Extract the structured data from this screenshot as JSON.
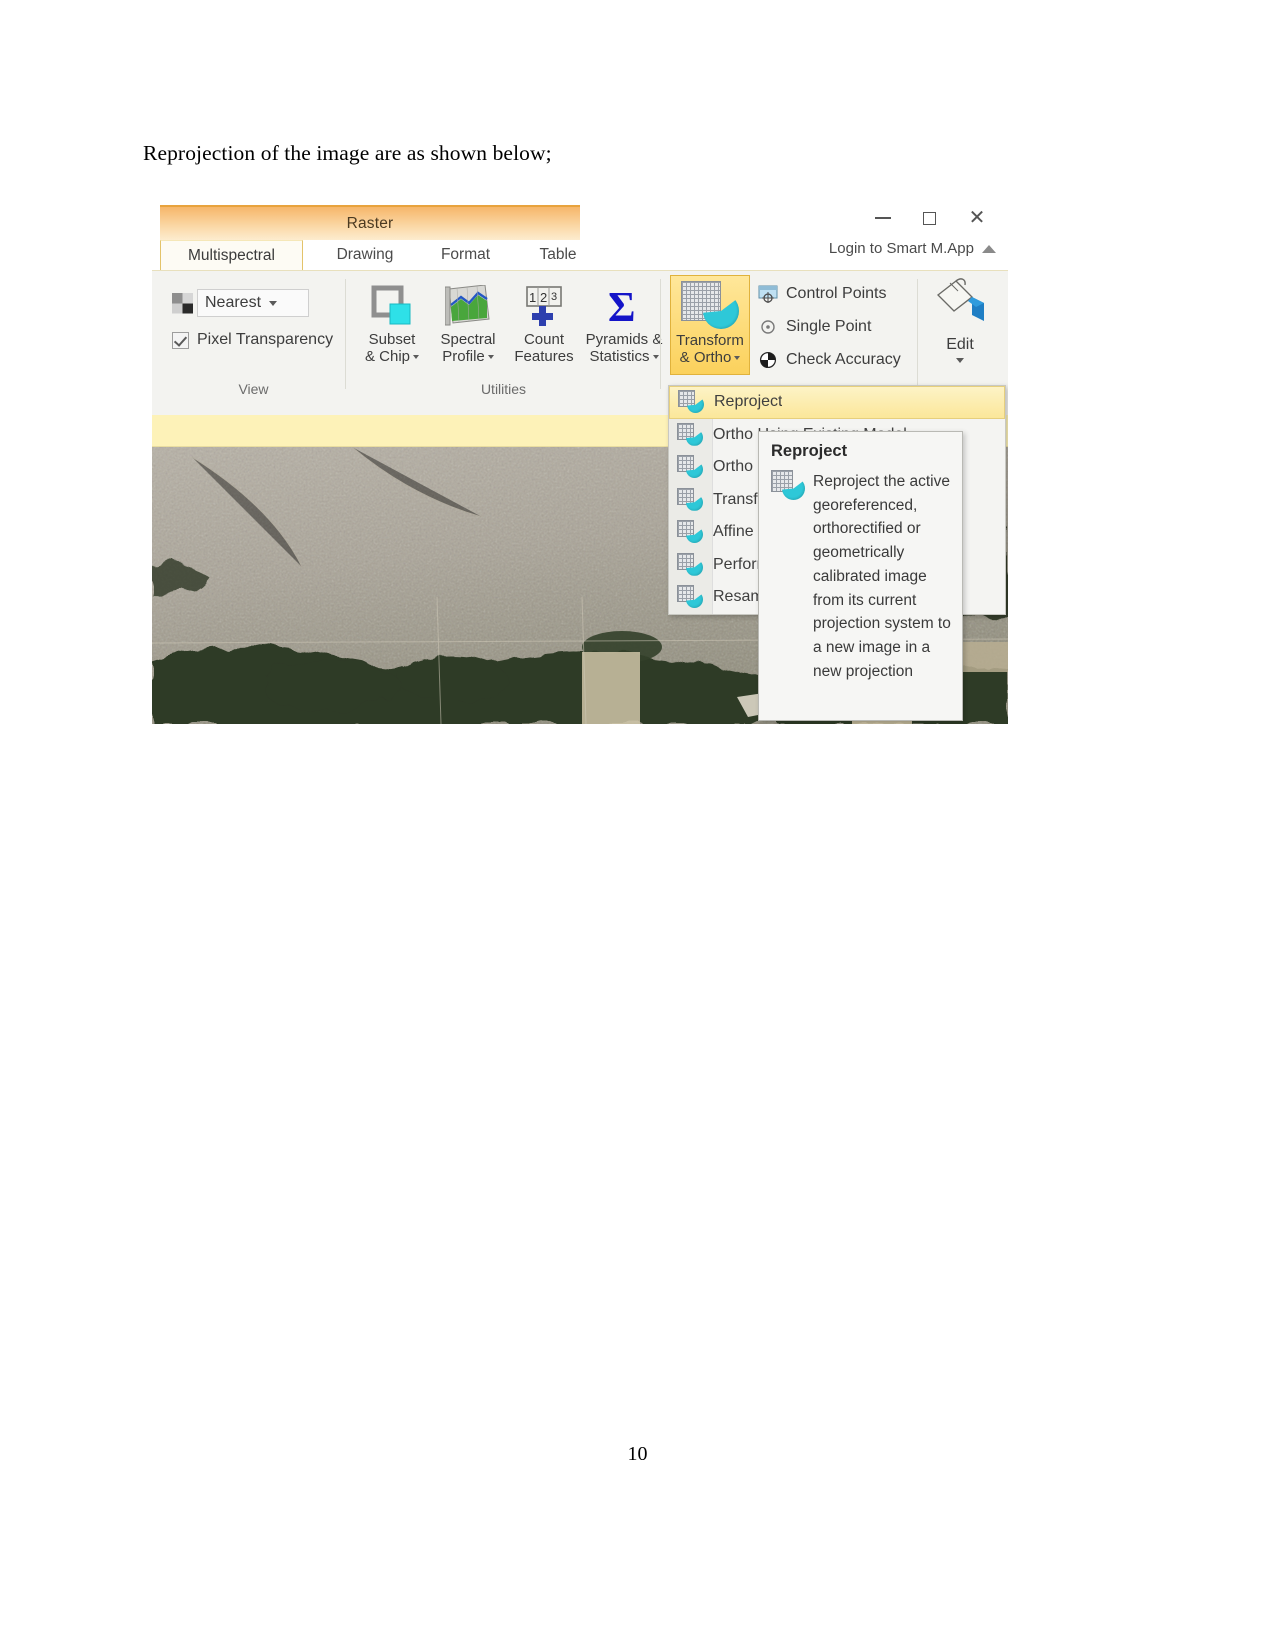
{
  "document": {
    "paragraph": "Reprojection of the image are as shown below;",
    "page_number": "10"
  },
  "window": {
    "context_tab_title": "Raster",
    "login_label": "Login to Smart M.App",
    "controls": {
      "minimize": "minimize-window",
      "maximize": "maximize-window",
      "close": "close-window"
    },
    "tabs": [
      {
        "label": "Multispectral",
        "active": true
      },
      {
        "label": "Drawing",
        "active": false
      },
      {
        "label": "Format",
        "active": false
      },
      {
        "label": "Table",
        "active": false
      }
    ]
  },
  "ribbon": {
    "groups": [
      {
        "name": "view",
        "label": "View",
        "resample_value": "Nearest",
        "pixel_transparency_label": "Pixel Transparency",
        "pixel_transparency_checked": true
      },
      {
        "name": "utilities",
        "label": "Utilities",
        "buttons": [
          {
            "label": "Subset\n& Chip",
            "has_caret": true
          },
          {
            "label": "Spectral\nProfile",
            "has_caret": true
          },
          {
            "label": "Count\nFeatures",
            "has_caret": false
          },
          {
            "label": "Pyramids &\nStatistics",
            "has_caret": true
          }
        ]
      },
      {
        "name": "transform",
        "label": "",
        "main_button": {
          "label": "Transform\n& Ortho",
          "has_caret": true,
          "active": true
        },
        "items": [
          {
            "label": "Control Points"
          },
          {
            "label": "Single Point"
          },
          {
            "label": "Check Accuracy"
          }
        ]
      },
      {
        "name": "edit",
        "label": "Edit",
        "has_caret": true
      }
    ]
  },
  "dropdown": {
    "items": [
      {
        "label": "Reproject",
        "selected": true
      },
      {
        "label": "Ortho Using Existing Model",
        "selected": false
      },
      {
        "label": "Ortho",
        "selected": false
      },
      {
        "label": "Transform",
        "selected": false
      },
      {
        "label": "Affine",
        "selected": false
      },
      {
        "label": "Perform",
        "selected": false
      },
      {
        "label": "Resample",
        "selected": false
      }
    ]
  },
  "tooltip": {
    "title": "Reproject",
    "description": "Reproject the active georeferenced, orthorectified or geometrically calibrated image from its current projection system to a new image in a new projection"
  },
  "colors": {
    "context_band": "#f6b66a",
    "active_highlight": "#fbd15c",
    "tooltip_bg": "#f6f6f4",
    "ribbon_bg": "#f3f3f0",
    "icon_teal": "#2ec8d8"
  }
}
